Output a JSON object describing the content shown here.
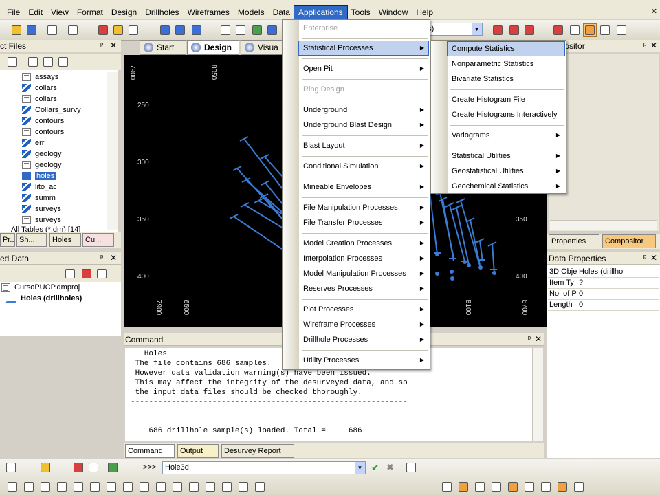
{
  "menubar": {
    "items": [
      "File",
      "Edit",
      "View",
      "Format",
      "Design",
      "Drillholes",
      "Wireframes",
      "Models",
      "Data",
      "Applications",
      "Tools",
      "Window",
      "Help"
    ],
    "active": "Applications"
  },
  "toolbar": {
    "combo_value": "es)"
  },
  "project_files": {
    "title": "ct Files",
    "items": [
      {
        "label": "assays",
        "icon": "table-icon"
      },
      {
        "label": "collars",
        "icon": "wireframe-icon"
      },
      {
        "label": "collars",
        "icon": "table-icon"
      },
      {
        "label": "Collars_survy",
        "icon": "wireframe-icon"
      },
      {
        "label": "contours",
        "icon": "wireframe-icon"
      },
      {
        "label": "contours",
        "icon": "table-icon"
      },
      {
        "label": "err",
        "icon": "wireframe-icon"
      },
      {
        "label": "geology",
        "icon": "wireframe-icon"
      },
      {
        "label": "geology",
        "icon": "table-icon"
      },
      {
        "label": "holes",
        "icon": "wireframe-icon",
        "selected": true
      },
      {
        "label": "lito_ac",
        "icon": "wireframe-icon"
      },
      {
        "label": "summ",
        "icon": "wireframe-icon"
      },
      {
        "label": "surveys",
        "icon": "wireframe-icon"
      },
      {
        "label": "surveys",
        "icon": "table-icon"
      }
    ],
    "footer": "All Tables (*.dm) [14]",
    "tabs": [
      "Pr...",
      "Sh...",
      "Holes",
      "Cu..."
    ]
  },
  "loaded_data": {
    "title": "ed Data",
    "project": "CursoPUCP.dmproj",
    "object": "Holes (drillholes)"
  },
  "view_tabs": [
    "Start",
    "Design",
    "Visua"
  ],
  "viewport": {
    "top_labels": [
      "7900",
      "8050"
    ],
    "bottom_labels": [
      "7900",
      "6500",
      "8100",
      "6700"
    ],
    "left_labels": [
      "250",
      "300",
      "350",
      "400"
    ],
    "right_labels": [
      "350",
      "400"
    ]
  },
  "command": {
    "title": "Command",
    "lines": [
      "   Holes",
      " The file contains 686 samples.",
      " However data validation warning(s) have been issued.",
      " This may affect the integrity of the desurveyed data, and so",
      " the input data files should be checked thoroughly.",
      "-------------------------------------------------------------",
      "",
      "",
      "    686 drillhole sample(s) loaded. Total =     686"
    ],
    "tabs": [
      "Command",
      "Output",
      "Desurvey Report"
    ]
  },
  "compositor": {
    "title": "ompositor",
    "tabs": [
      "Properties",
      "Compositor"
    ]
  },
  "data_properties": {
    "title": "Data Properties",
    "rows": [
      {
        "key": "3D Obje",
        "value": "Holes (drillhol"
      },
      {
        "key": "Item Ty",
        "value": "?"
      },
      {
        "key": "No. of P",
        "value": "0"
      },
      {
        "key": "Length",
        "value": "0"
      }
    ]
  },
  "applications_menu": {
    "items": [
      {
        "label": "Enterprise",
        "disabled": true,
        "sub": false
      },
      {
        "label": "Statistical Processes",
        "sub": true,
        "highlight": true
      },
      {
        "label": "Open Pit",
        "sub": true
      },
      {
        "label": "Ring Design",
        "disabled": true,
        "sub": false
      },
      {
        "label": "Underground",
        "sub": true
      },
      {
        "label": "Underground Blast Design",
        "sub": true
      },
      {
        "label": "Blast Layout",
        "sub": true
      },
      {
        "label": "Conditional Simulation",
        "sub": true
      },
      {
        "label": "Mineable Envelopes",
        "sub": true
      },
      {
        "label": "File Manipulation Processes",
        "sub": true
      },
      {
        "label": "File Transfer Processes",
        "sub": true
      },
      {
        "label": "Model Creation Processes",
        "sub": true
      },
      {
        "label": "Interpolation Processes",
        "sub": true
      },
      {
        "label": "Model Manipulation Processes",
        "sub": true
      },
      {
        "label": "Reserves Processes",
        "sub": true
      },
      {
        "label": "Plot Processes",
        "sub": true
      },
      {
        "label": "Wireframe Processes",
        "sub": true
      },
      {
        "label": "Drillhole Processes",
        "sub": true
      },
      {
        "label": "Utility Processes",
        "sub": true
      }
    ]
  },
  "statistical_submenu": {
    "items": [
      {
        "label": "Compute Statistics",
        "highlight": true,
        "sub": false
      },
      {
        "label": "Nonparametric Statistics",
        "sub": false
      },
      {
        "label": "Bivariate Statistics",
        "sub": false
      },
      {
        "label": "Create Histogram File",
        "sub": false
      },
      {
        "label": "Create Histograms Interactively",
        "sub": false
      },
      {
        "label": "Variograms",
        "sub": true
      },
      {
        "label": "Statistical Utilities",
        "sub": true
      },
      {
        "label": "Geostatistical Utilities",
        "sub": true
      },
      {
        "label": "Geochemical Statistics",
        "sub": true
      }
    ]
  },
  "statusbar": {
    "prompt": "!>>>",
    "command_value": "Hole3d"
  },
  "colors": {
    "accent": "#316ac5",
    "drillhole": "#3a7bd5",
    "viewport_bg": "#000000"
  }
}
